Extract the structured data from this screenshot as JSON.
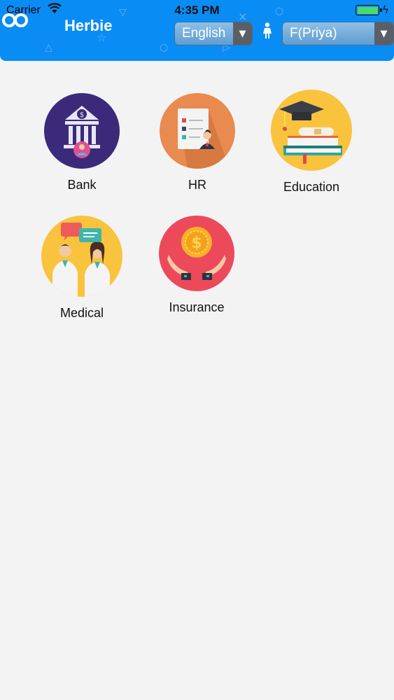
{
  "status_bar": {
    "carrier": "Carrier",
    "time": "4:35 PM"
  },
  "header": {
    "title": "Herbie",
    "language_select": {
      "value": "English"
    },
    "user_select": {
      "value": "F(Priya)"
    },
    "bg_color": "#0a8cf5"
  },
  "categories": [
    {
      "label": "Bank",
      "icon": "bank-icon",
      "color": "#3b2a7a"
    },
    {
      "label": "HR",
      "icon": "hr-icon",
      "color": "#e98a4e"
    },
    {
      "label": "Education",
      "icon": "education-icon",
      "color": "#f9c33d"
    },
    {
      "label": "Medical",
      "icon": "medical-icon",
      "color": "#f9c33d"
    },
    {
      "label": "Insurance",
      "icon": "insurance-icon",
      "color": "#ec4a5a"
    }
  ]
}
